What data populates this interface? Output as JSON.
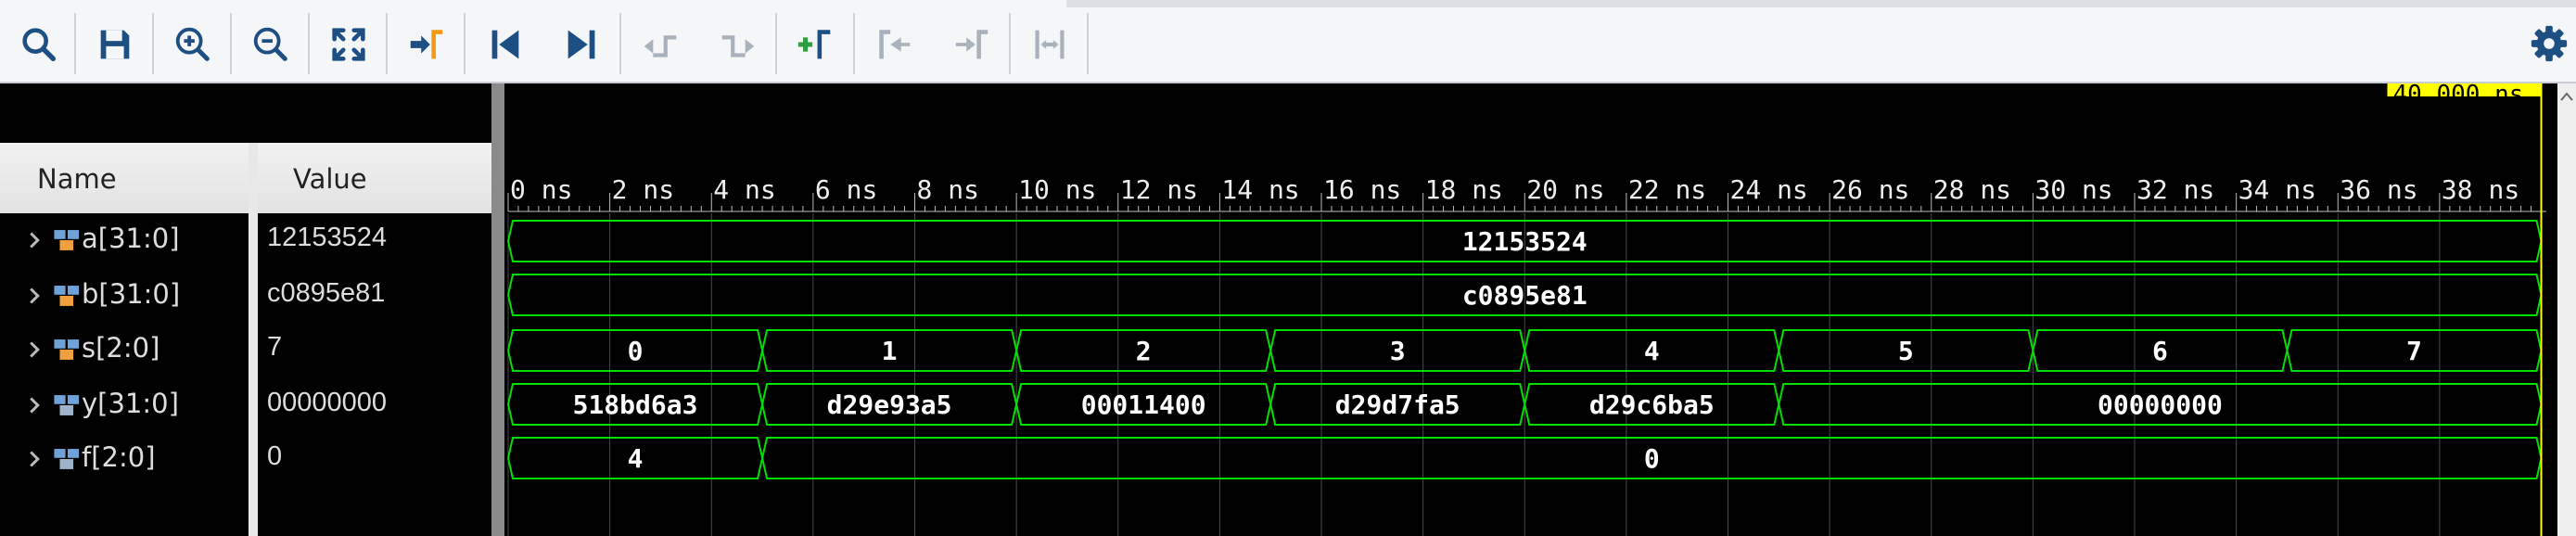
{
  "toolbar": {
    "buttons": [
      {
        "name": "search-button",
        "icon": "search-icon"
      },
      {
        "name": "save-button",
        "icon": "save-icon"
      },
      {
        "name": "zoom-in-button",
        "icon": "zoom-in-icon"
      },
      {
        "name": "zoom-out-button",
        "icon": "zoom-out-icon"
      },
      {
        "name": "zoom-fit-button",
        "icon": "zoom-fit-icon"
      },
      {
        "name": "go-to-cursor-button",
        "icon": "go-to-cursor-icon"
      },
      {
        "name": "go-to-time-zero-button",
        "icon": "go-to-start-icon"
      },
      {
        "name": "go-to-last-time-button",
        "icon": "go-to-end-icon"
      },
      {
        "name": "previous-transition-button",
        "icon": "previous-transition-icon"
      },
      {
        "name": "next-transition-button",
        "icon": "next-transition-icon"
      },
      {
        "name": "add-marker-button",
        "icon": "add-marker-icon"
      },
      {
        "name": "previous-marker-button",
        "icon": "previous-marker-icon"
      },
      {
        "name": "next-marker-button",
        "icon": "next-marker-icon"
      },
      {
        "name": "swap-cursors-button",
        "icon": "swap-cursors-icon"
      }
    ],
    "settings_icon": "gear-icon"
  },
  "colors": {
    "waveform": "#00e000",
    "cursor": "#ffff00",
    "toolbar_icon": "#1e4f82",
    "accent_orange": "#f39c12",
    "accent_green": "#2e9e3e"
  },
  "names_panel": {
    "name_header": "Name",
    "value_header": "Value"
  },
  "signals": [
    {
      "name": "a[31:0]",
      "value": "12153524"
    },
    {
      "name": "b[31:0]",
      "value": "c0895e81"
    },
    {
      "name": "s[2:0]",
      "value": "7"
    },
    {
      "name": "y[31:0]",
      "value": "00000000"
    },
    {
      "name": "f[2:0]",
      "value": "0"
    }
  ],
  "waveform": {
    "cursor_label": "40.000 ns",
    "cursor_time": 40,
    "time_range": [
      0,
      40.1
    ],
    "tick_labels": [
      "0 ns",
      "2 ns",
      "4 ns",
      "6 ns",
      "8 ns",
      "10 ns",
      "12 ns",
      "14 ns",
      "16 ns",
      "18 ns",
      "20 ns",
      "22 ns",
      "24 ns",
      "26 ns",
      "28 ns",
      "30 ns",
      "32 ns",
      "34 ns",
      "36 ns",
      "38 ns"
    ],
    "tick_values": [
      0,
      2,
      4,
      6,
      8,
      10,
      12,
      14,
      16,
      18,
      20,
      22,
      24,
      26,
      28,
      30,
      32,
      34,
      36,
      38
    ],
    "traces": [
      {
        "segments": [
          {
            "start": 0,
            "end": 40,
            "label": "12153524"
          }
        ]
      },
      {
        "segments": [
          {
            "start": 0,
            "end": 40,
            "label": "c0895e81"
          }
        ]
      },
      {
        "segments": [
          {
            "start": 0,
            "end": 5,
            "label": "0"
          },
          {
            "start": 5,
            "end": 10,
            "label": "1"
          },
          {
            "start": 10,
            "end": 15,
            "label": "2"
          },
          {
            "start": 15,
            "end": 20,
            "label": "3"
          },
          {
            "start": 20,
            "end": 25,
            "label": "4"
          },
          {
            "start": 25,
            "end": 30,
            "label": "5"
          },
          {
            "start": 30,
            "end": 35,
            "label": "6"
          },
          {
            "start": 35,
            "end": 40,
            "label": "7"
          }
        ]
      },
      {
        "segments": [
          {
            "start": 0,
            "end": 5,
            "label": "518bd6a3"
          },
          {
            "start": 5,
            "end": 10,
            "label": "d29e93a5"
          },
          {
            "start": 10,
            "end": 15,
            "label": "00011400"
          },
          {
            "start": 15,
            "end": 20,
            "label": "d29d7fa5"
          },
          {
            "start": 20,
            "end": 25,
            "label": "d29c6ba5"
          },
          {
            "start": 25,
            "end": 40,
            "label": "00000000"
          }
        ]
      },
      {
        "segments": [
          {
            "start": 0,
            "end": 5,
            "label": "4"
          },
          {
            "start": 5,
            "end": 40,
            "label": "0"
          }
        ]
      }
    ]
  }
}
